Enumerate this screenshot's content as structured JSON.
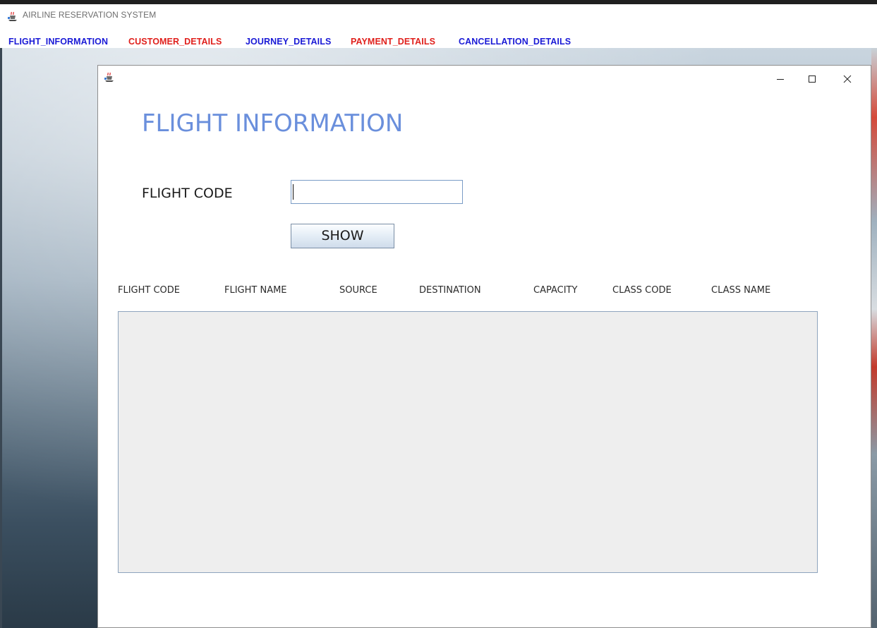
{
  "app": {
    "title": "AIRLINE RESERVATION SYSTEM",
    "icon": "java-cup-icon"
  },
  "menu": {
    "items": [
      {
        "label": "FLIGHT_INFORMATION",
        "color": "#1a1ad6"
      },
      {
        "label": "CUSTOMER_DETAILS",
        "color": "#e0201c"
      },
      {
        "label": "JOURNEY_DETAILS",
        "color": "#1a1ad6"
      },
      {
        "label": "PAYMENT_DETAILS",
        "color": "#e0201c"
      },
      {
        "label": "CANCELLATION_DETAILS",
        "color": "#1a1ad6"
      }
    ]
  },
  "window": {
    "icon": "java-cup-icon",
    "controls": [
      "minimize-icon",
      "maximize-icon",
      "close-icon"
    ]
  },
  "form": {
    "heading": "FLIGHT INFORMATION",
    "heading_color": "#6a8fdc",
    "flight_code_label": "FLIGHT CODE",
    "flight_code_value": "",
    "show_button": "SHOW"
  },
  "table": {
    "columns": [
      "FLIGHT CODE",
      "FLIGHT NAME",
      "SOURCE",
      "DESTINATION",
      "CAPACITY",
      "CLASS CODE",
      "CLASS NAME"
    ],
    "rows": []
  }
}
